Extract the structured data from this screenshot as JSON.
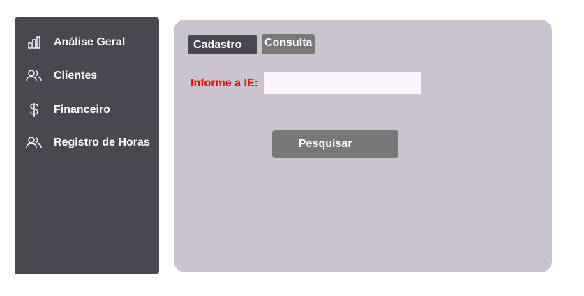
{
  "sidebar": {
    "items": [
      {
        "label": "Análise Geral",
        "icon": "bar-chart-icon"
      },
      {
        "label": "Clientes",
        "icon": "users-icon"
      },
      {
        "label": "Financeiro",
        "icon": "dollar-icon"
      },
      {
        "label": "Registro de Horas",
        "icon": "users-icon"
      }
    ]
  },
  "tabs": {
    "cadastro": "Cadastro",
    "consulta": "Consulta"
  },
  "form": {
    "ie_label": "Informe a IE:",
    "ie_value": "",
    "ie_placeholder": "",
    "search_label": "Pesquisar"
  },
  "colors": {
    "sidebar_bg": "#4a4750",
    "panel_bg": "#cac4d0",
    "tab_active": "#4a4750",
    "tab_inactive": "#777777",
    "button_bg": "#777777",
    "input_bg": "#fdf6ff",
    "label_accent": "#ff0000"
  }
}
